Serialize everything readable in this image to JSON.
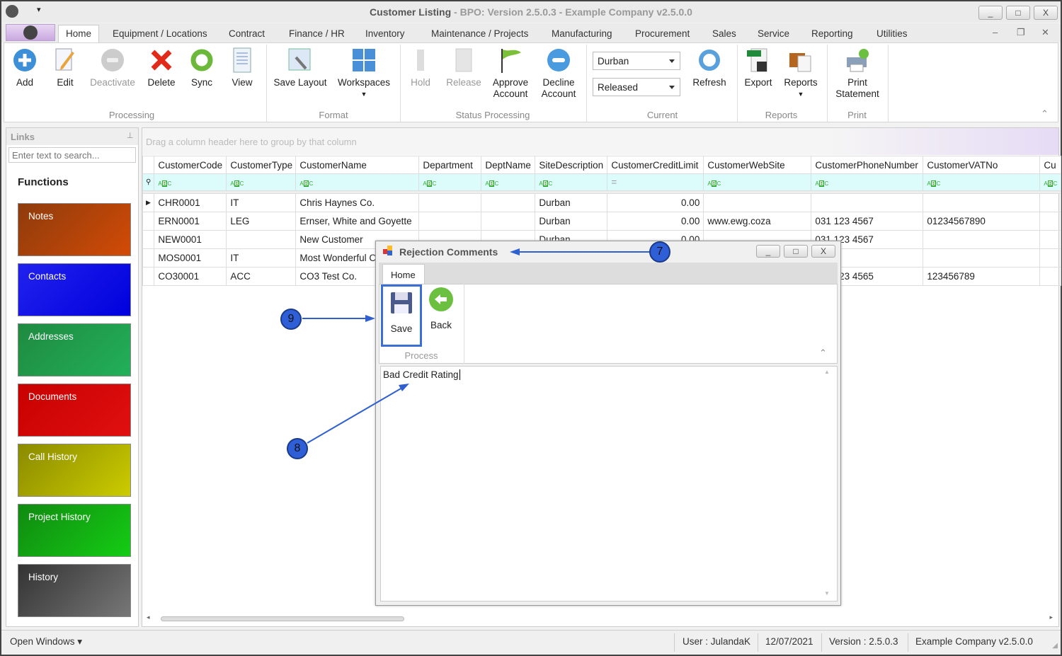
{
  "window": {
    "title": "Customer Listing",
    "subtitle": " - BPO: Version 2.5.0.3 - Example Company v2.5.0.0",
    "min": "_",
    "max": "□",
    "close": "X"
  },
  "tabs": [
    "Home",
    "Equipment / Locations",
    "Contract",
    "Finance / HR",
    "Inventory",
    "Maintenance / Projects",
    "Manufacturing",
    "Procurement",
    "Sales",
    "Service",
    "Reporting",
    "Utilities"
  ],
  "ribbon": {
    "processing": {
      "label": "Processing",
      "buttons": [
        "Add",
        "Edit",
        "Deactivate",
        "Delete",
        "Sync",
        "View"
      ]
    },
    "format": {
      "label": "Format",
      "buttons": [
        "Save Layout",
        "Workspaces"
      ]
    },
    "status": {
      "label": "Status Processing",
      "buttons": [
        "Hold",
        "Release",
        "Approve Account",
        "Decline Account"
      ]
    },
    "current": {
      "label": "Current",
      "site": "Durban",
      "status": "Released",
      "refresh": "Refresh"
    },
    "reports": {
      "label": "Reports",
      "buttons": [
        "Export",
        "Reports"
      ]
    },
    "print": {
      "label": "Print",
      "buttons": [
        "Print Statement"
      ]
    }
  },
  "links": {
    "title": "Links",
    "search_placeholder": "Enter text to search...",
    "functions": "Functions",
    "tiles": [
      {
        "label": "Notes",
        "color": "#b5420c"
      },
      {
        "label": "Contacts",
        "color": "#1a1aee"
      },
      {
        "label": "Addresses",
        "color": "#1e9e4c"
      },
      {
        "label": "Documents",
        "color": "#d20d0d"
      },
      {
        "label": "Call History",
        "color": "#b3b300"
      },
      {
        "label": "Project History",
        "color": "#13b313"
      },
      {
        "label": "History",
        "color": "#555555"
      }
    ]
  },
  "grid": {
    "group_hint": "Drag a column header here to group by that column",
    "columns": [
      "CustomerCode",
      "CustomerType",
      "CustomerName",
      "Department",
      "DeptName",
      "SiteDescription",
      "CustomerCreditLimit",
      "CustomerWebSite",
      "CustomerPhoneNumber",
      "CustomerVATNo",
      "Cu"
    ],
    "rows": [
      [
        "CHR0001",
        "IT",
        "Chris Haynes Co.",
        "",
        "",
        "Durban",
        "0.00",
        "",
        "",
        "",
        ""
      ],
      [
        "ERN0001",
        "LEG",
        "Ernser, White and Goyette",
        "",
        "",
        "Durban",
        "0.00",
        "www.ewg.coza",
        "031 123 4567",
        "01234567890",
        ""
      ],
      [
        "NEW0001",
        "",
        "New Customer",
        "",
        "",
        "Durban",
        "0.00",
        "",
        "031 123 4567",
        "",
        ""
      ],
      [
        "MOS0001",
        "IT",
        "Most Wonderful Co",
        "",
        "",
        "",
        "",
        "",
        "",
        "",
        ""
      ],
      [
        "CO30001",
        "ACC",
        "CO3 Test Co.",
        "",
        "",
        "",
        "",
        "",
        "031 123 4565",
        "123456789",
        ""
      ]
    ]
  },
  "dialog": {
    "title": "Rejection Comments",
    "tab": "Home",
    "save": "Save",
    "back": "Back",
    "group": "Process",
    "comment": "Bad Credit Rating"
  },
  "callouts": [
    "7",
    "8",
    "9"
  ],
  "status": {
    "open_windows": "Open Windows",
    "user": "User : JulandaK",
    "date": "12/07/2021",
    "version": "Version : 2.5.0.3",
    "company": "Example Company v2.5.0.0"
  }
}
